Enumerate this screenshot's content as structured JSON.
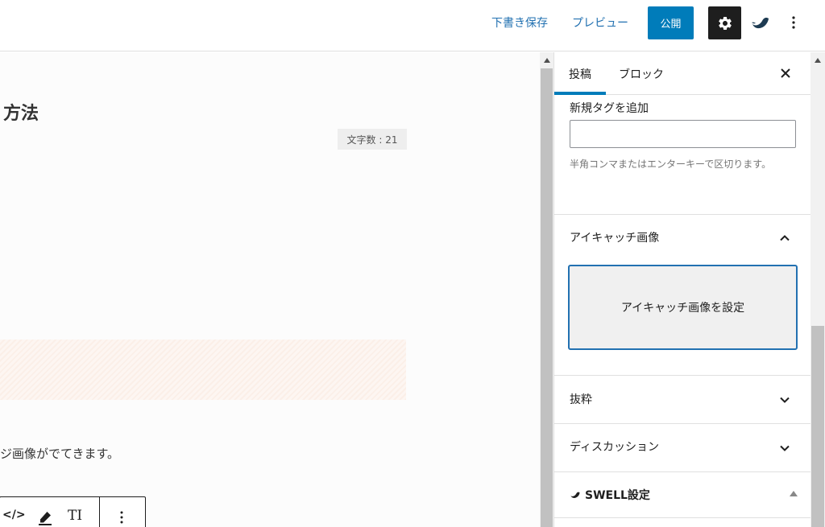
{
  "header": {
    "save_draft_label": "下書き保存",
    "preview_label": "プレビュー",
    "publish_label": "公開"
  },
  "editor": {
    "title_fragment": "方法",
    "word_count": "文字数 : 21",
    "body_text_fragment": "ジ画像がでてきます。",
    "toolbar": {
      "text_size_label": "TI"
    }
  },
  "sidebar": {
    "tabs": [
      {
        "label": "投稿",
        "active": true
      },
      {
        "label": "ブロック",
        "active": false
      }
    ],
    "tags": {
      "label": "新規タグを追加",
      "value": "",
      "help": "半角コンマまたはエンターキーで区切ります。"
    },
    "panels": {
      "featured_image": {
        "title": "アイキャッチ画像",
        "expanded": true,
        "button_label": "アイキャッチ画像を設定"
      },
      "excerpt": {
        "title": "抜粋",
        "expanded": false
      },
      "discussion": {
        "title": "ディスカッション",
        "expanded": false
      },
      "swell": {
        "title": "SWELL設定",
        "expanded": true
      }
    }
  },
  "colors": {
    "accent": "#007cba",
    "link": "#2271b1",
    "dark": "#1e1e1e"
  }
}
